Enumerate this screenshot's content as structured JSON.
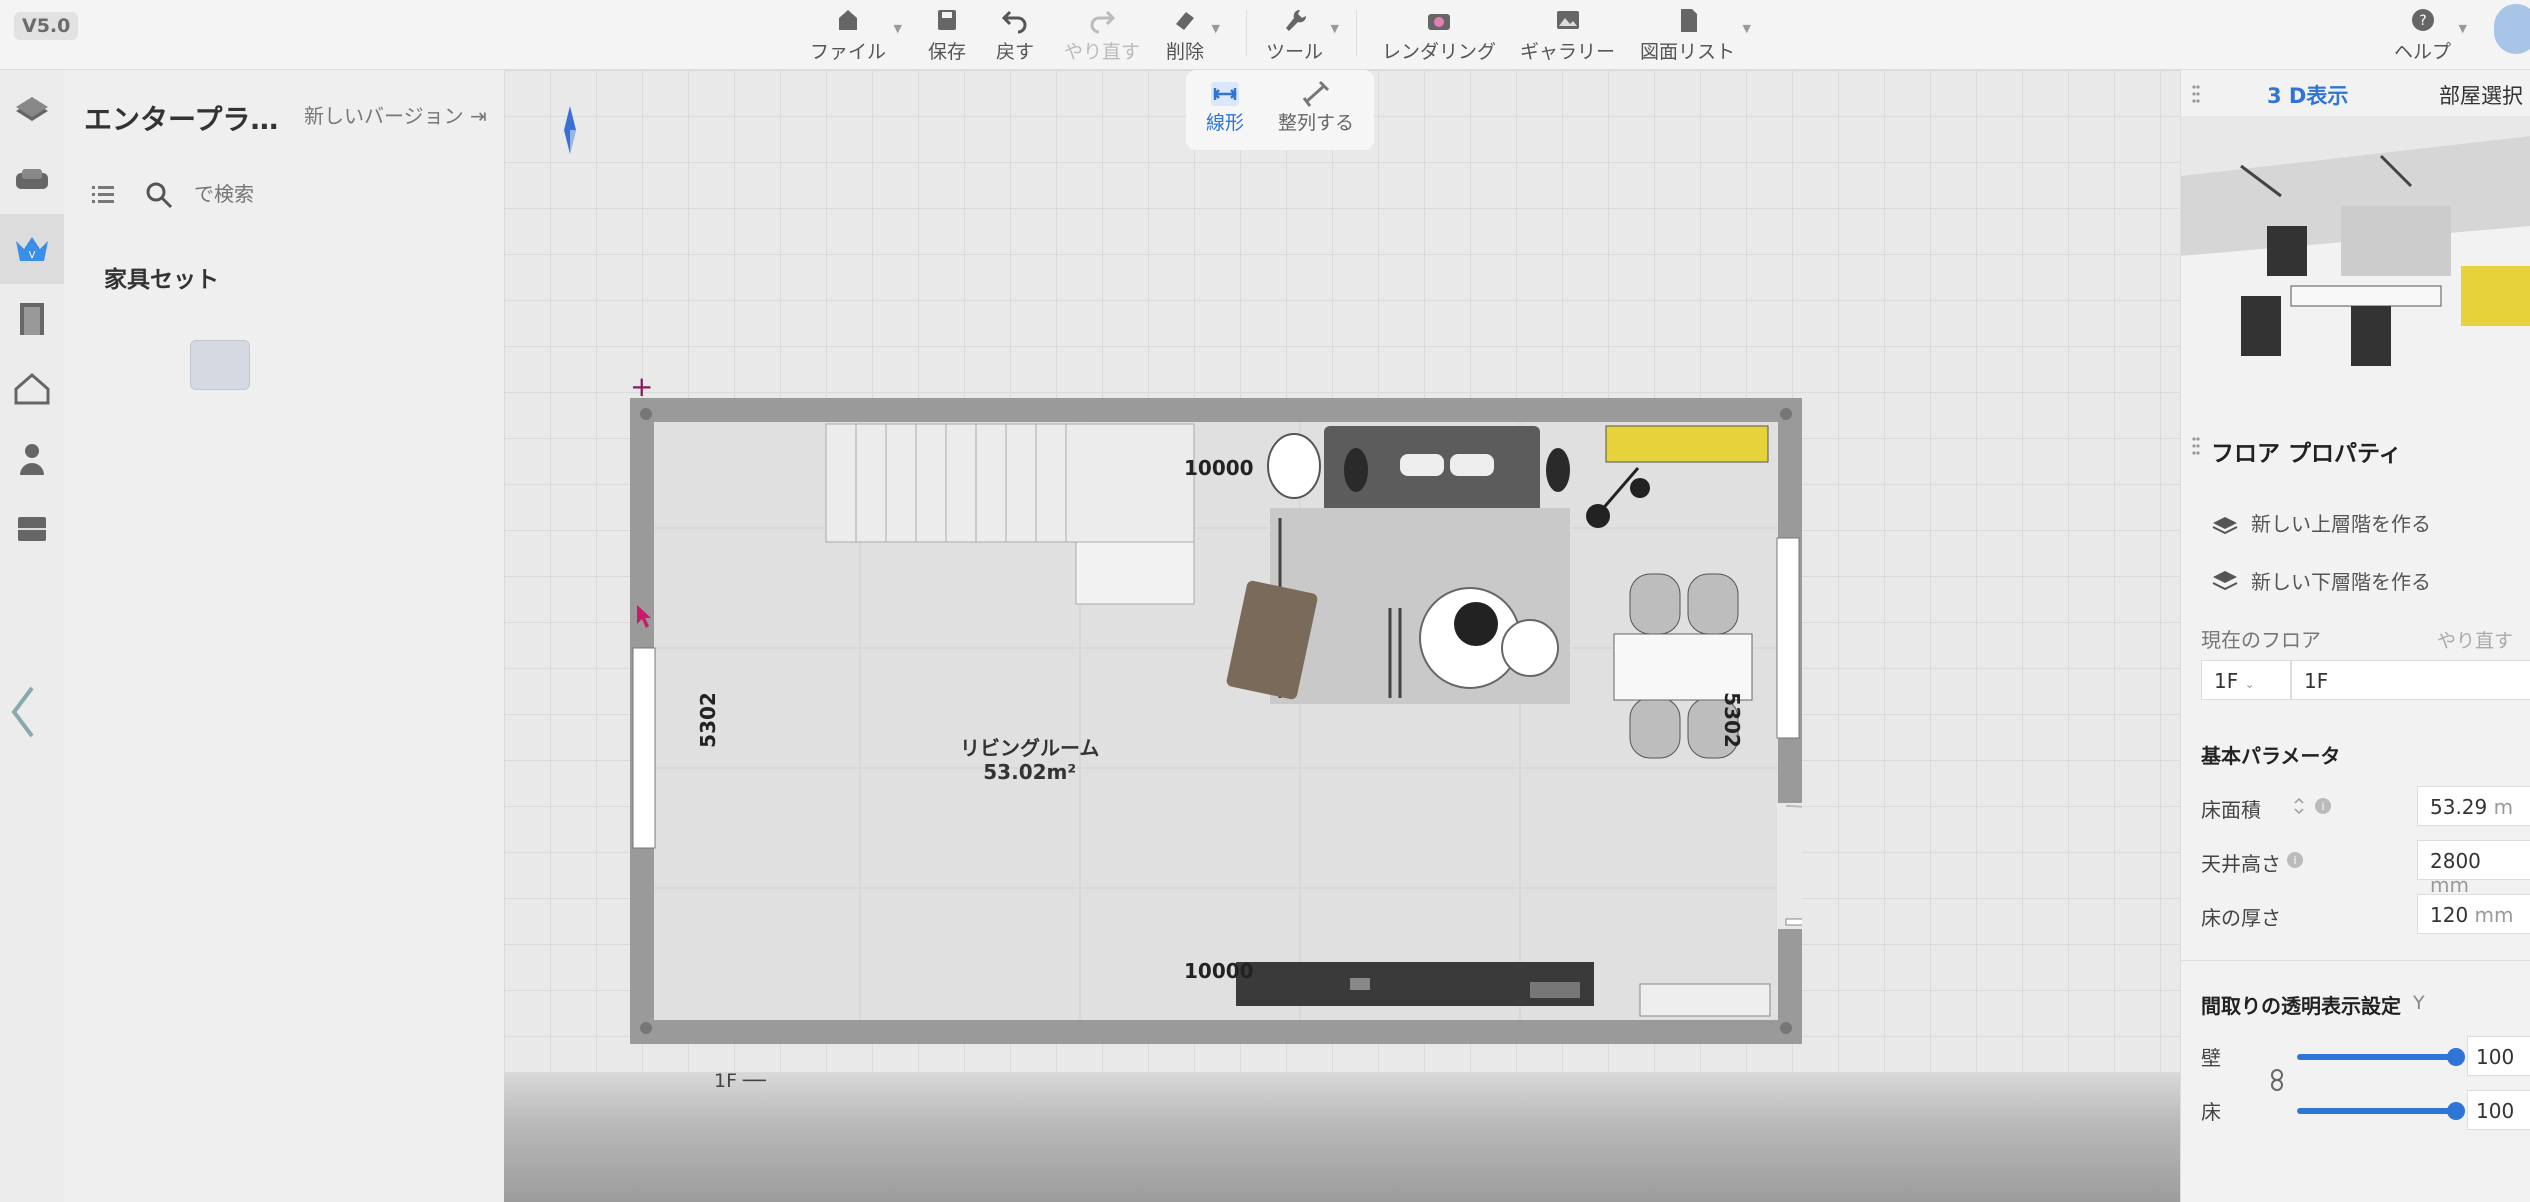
{
  "version": "V5.0",
  "toolbar": {
    "file": "ファイル",
    "save": "保存",
    "undo": "戻す",
    "redo": "やり直す",
    "delete": "削除",
    "tools": "ツール",
    "render": "レンダリング",
    "gallery": "ギャラリー",
    "drawings": "図面リスト",
    "help": "ヘルプ"
  },
  "left_panel": {
    "project_title": "エンタープラ…",
    "new_version": "新しいバージョン",
    "search_placeholder": "で検索",
    "section_title": "家具セット"
  },
  "rail": {
    "icons": [
      "floorplan-icon",
      "furniture-icon",
      "crown-icon",
      "door-icon",
      "house-icon",
      "person-icon",
      "cabinet-icon"
    ]
  },
  "canvas": {
    "mode_linear": "線形",
    "mode_align": "整列する",
    "room_name": "リビングルーム",
    "room_area": "53.02m²",
    "dim_top": "10000",
    "dim_bottom": "10000",
    "dim_left": "5302",
    "dim_right": "5302",
    "floor_tag": "1F ──"
  },
  "right_panel": {
    "tab_3d": "3 D表示",
    "tab_room": "部屋選択",
    "floor_props_title": "フロア プロパティ",
    "new_upper": "新しい上層階を作る",
    "new_lower": "新しい下層階を作る",
    "current_floor_label": "現在のフロア",
    "redo_label": "やり直す",
    "floor_select": "1F",
    "floor_name": "1F",
    "basic_params": "基本パラメータ",
    "floor_area_label": "床面積",
    "floor_area_value": "53.29",
    "floor_area_unit": "m",
    "ceiling_label": "天井高さ",
    "ceiling_value": "2800",
    "ceiling_unit": "mm",
    "floor_thick_label": "床の厚さ",
    "floor_thick_value": "120",
    "floor_thick_unit": "mm",
    "transparency_title": "間取りの透明表示設定",
    "transparency_toggle": "Y",
    "wall_label": "壁",
    "wall_value": "100",
    "floor_label": "床",
    "floor_value": "100",
    "wall_opacity": 1.0,
    "floor_opacity": 1.0
  },
  "colors": {
    "accent": "#2f75d6",
    "wall": "#9a9a9a",
    "sideboard": "#e6d33c"
  }
}
